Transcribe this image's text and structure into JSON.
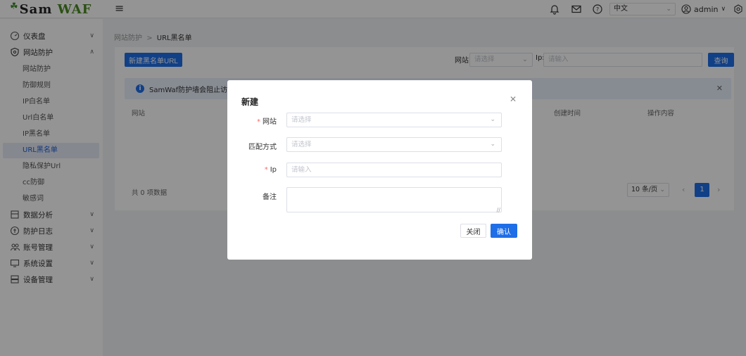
{
  "app": {
    "logo_sam": "Sam",
    "logo_waf": "WAF"
  },
  "topbar": {
    "language": "中文",
    "username": "admin"
  },
  "sidebar": {
    "groups": [
      {
        "label": "仪表盘",
        "icon": "dashboard-icon"
      },
      {
        "label": "网站防护",
        "icon": "shield-icon"
      },
      {
        "label": "数据分析",
        "icon": "chart-icon"
      },
      {
        "label": "防护日志",
        "icon": "log-icon"
      },
      {
        "label": "账号管理",
        "icon": "users-icon"
      },
      {
        "label": "系统设置",
        "icon": "monitor-icon"
      },
      {
        "label": "设备管理",
        "icon": "server-icon"
      }
    ],
    "items": [
      "网站防护",
      "防御规则",
      "IP白名单",
      "Url白名单",
      "IP黑名单",
      "URL黑名单",
      "隐私保护Url",
      "cc防御",
      "敏感词"
    ]
  },
  "breadcrumb": {
    "parent": "网站防护",
    "separator": ">",
    "current": "URL黑名单"
  },
  "toolbar": {
    "new_button": "新建黑名单URL",
    "site_label": "网站:",
    "site_placeholder": "请选择",
    "ip_label": "Ip:",
    "ip_placeholder": "请输入",
    "search_button": "查询"
  },
  "alert": {
    "text": "SamWaf防护墙会阻止访问该"
  },
  "table": {
    "columns": [
      "网站",
      "创建时间",
      "操作内容"
    ]
  },
  "pagination": {
    "total": "共 0 项数据",
    "page_size": "10 条/页",
    "current_page": "1"
  },
  "dialog": {
    "title": "新建",
    "fields": [
      {
        "label": "网站",
        "required": true,
        "placeholder": "请选择"
      },
      {
        "label": "匹配方式",
        "required": false,
        "placeholder": "请选择"
      },
      {
        "label": "Ip",
        "required": true,
        "placeholder": "请输入"
      },
      {
        "label": "备注",
        "required": false,
        "placeholder": ""
      }
    ],
    "close_button": "关闭",
    "confirm_button": "确认"
  }
}
